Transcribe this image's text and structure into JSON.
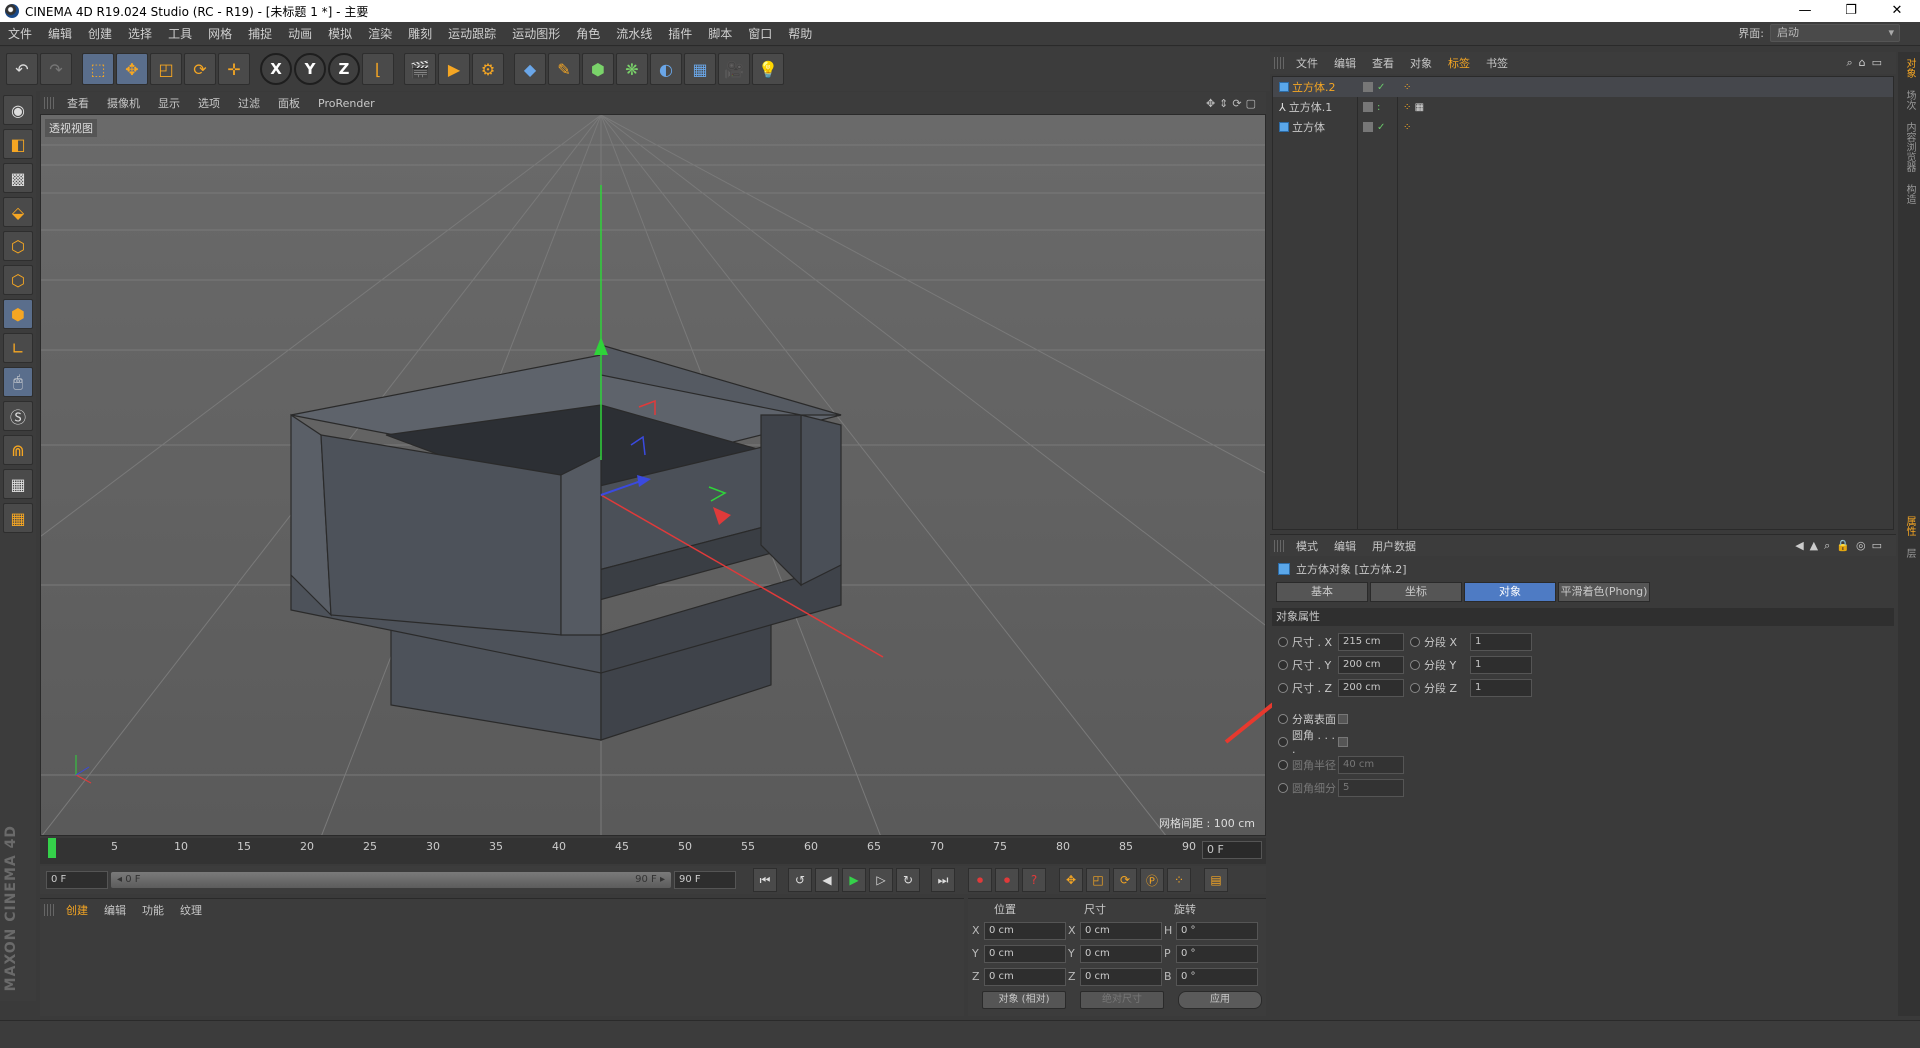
{
  "titlebar": {
    "title": "CINEMA 4D R19.024 Studio (RC - R19) - [未标题 1 *] - 主要",
    "minimize": "—",
    "maximize": "❐",
    "close": "✕"
  },
  "menubar": {
    "items": [
      "文件",
      "编辑",
      "创建",
      "选择",
      "工具",
      "网格",
      "捕捉",
      "动画",
      "模拟",
      "渲染",
      "雕刻",
      "运动跟踪",
      "运动图形",
      "角色",
      "流水线",
      "插件",
      "脚本",
      "窗口",
      "帮助"
    ],
    "layout_label": "界面:",
    "layout_value": "启动"
  },
  "viewport": {
    "menu": [
      "查看",
      "摄像机",
      "显示",
      "选项",
      "过滤",
      "面板",
      "ProRender"
    ],
    "label": "透视视图",
    "grid_info": "网格间距 : 100 cm"
  },
  "timeline": {
    "ticks": [
      "0",
      "5",
      "10",
      "15",
      "20",
      "25",
      "30",
      "35",
      "40",
      "45",
      "50",
      "55",
      "60",
      "65",
      "70",
      "75",
      "80",
      "85",
      "90"
    ],
    "current_frame": "0 F",
    "start_field": "0 F",
    "slider_left": "◂ 0 F",
    "slider_right": "90 F ▸",
    "end_field": "90 F"
  },
  "material_manager": {
    "menu": [
      "创建",
      "编辑",
      "功能",
      "纹理"
    ]
  },
  "coordinates": {
    "headers": [
      "位置",
      "尺寸",
      "旋转"
    ],
    "rows": [
      {
        "ax1": "X",
        "pos": "0 cm",
        "ax2": "X",
        "size": "0 cm",
        "ax3": "H",
        "rot": "0 °"
      },
      {
        "ax1": "Y",
        "pos": "0 cm",
        "ax2": "Y",
        "size": "0 cm",
        "ax3": "P",
        "rot": "0 °"
      },
      {
        "ax1": "Z",
        "pos": "0 cm",
        "ax2": "Z",
        "size": "0 cm",
        "ax3": "B",
        "rot": "0 °"
      }
    ],
    "mode": "对象 (相对)",
    "size_mode": "绝对尺寸",
    "apply": "应用"
  },
  "object_manager": {
    "menu": [
      "文件",
      "编辑",
      "查看",
      "对象",
      "标签",
      "书签"
    ],
    "objects": [
      {
        "name": "立方体.2",
        "selected": true
      },
      {
        "name": "立方体.1",
        "selected": false
      },
      {
        "name": "立方体",
        "selected": false
      }
    ]
  },
  "attribute_manager": {
    "menu": [
      "模式",
      "编辑",
      "用户数据"
    ],
    "object_title": "立方体对象 [立方体.2]",
    "tabs": [
      "基本",
      "坐标",
      "对象",
      "平滑着色(Phong)"
    ],
    "active_tab": "对象",
    "section": "对象属性",
    "size_x_label": "尺寸 . X",
    "size_x": "215 cm",
    "size_y_label": "尺寸 . Y",
    "size_y": "200 cm",
    "size_z_label": "尺寸 . Z",
    "size_z": "200 cm",
    "seg_x_label": "分段 X",
    "seg_x": "1",
    "seg_y_label": "分段 Y",
    "seg_y": "1",
    "seg_z_label": "分段 Z",
    "seg_z": "1",
    "separate_surfaces": "分离表面",
    "fillet": "圆角 . . . .",
    "fillet_radius_label": "圆角半径",
    "fillet_radius": "40 cm",
    "fillet_subdiv_label": "圆角细分",
    "fillet_subdiv": "5"
  },
  "side_tabs": [
    "对象",
    "场次",
    "内容浏览器",
    "构造",
    "属性",
    "层"
  ],
  "brand": "MAXON CINEMA 4D"
}
